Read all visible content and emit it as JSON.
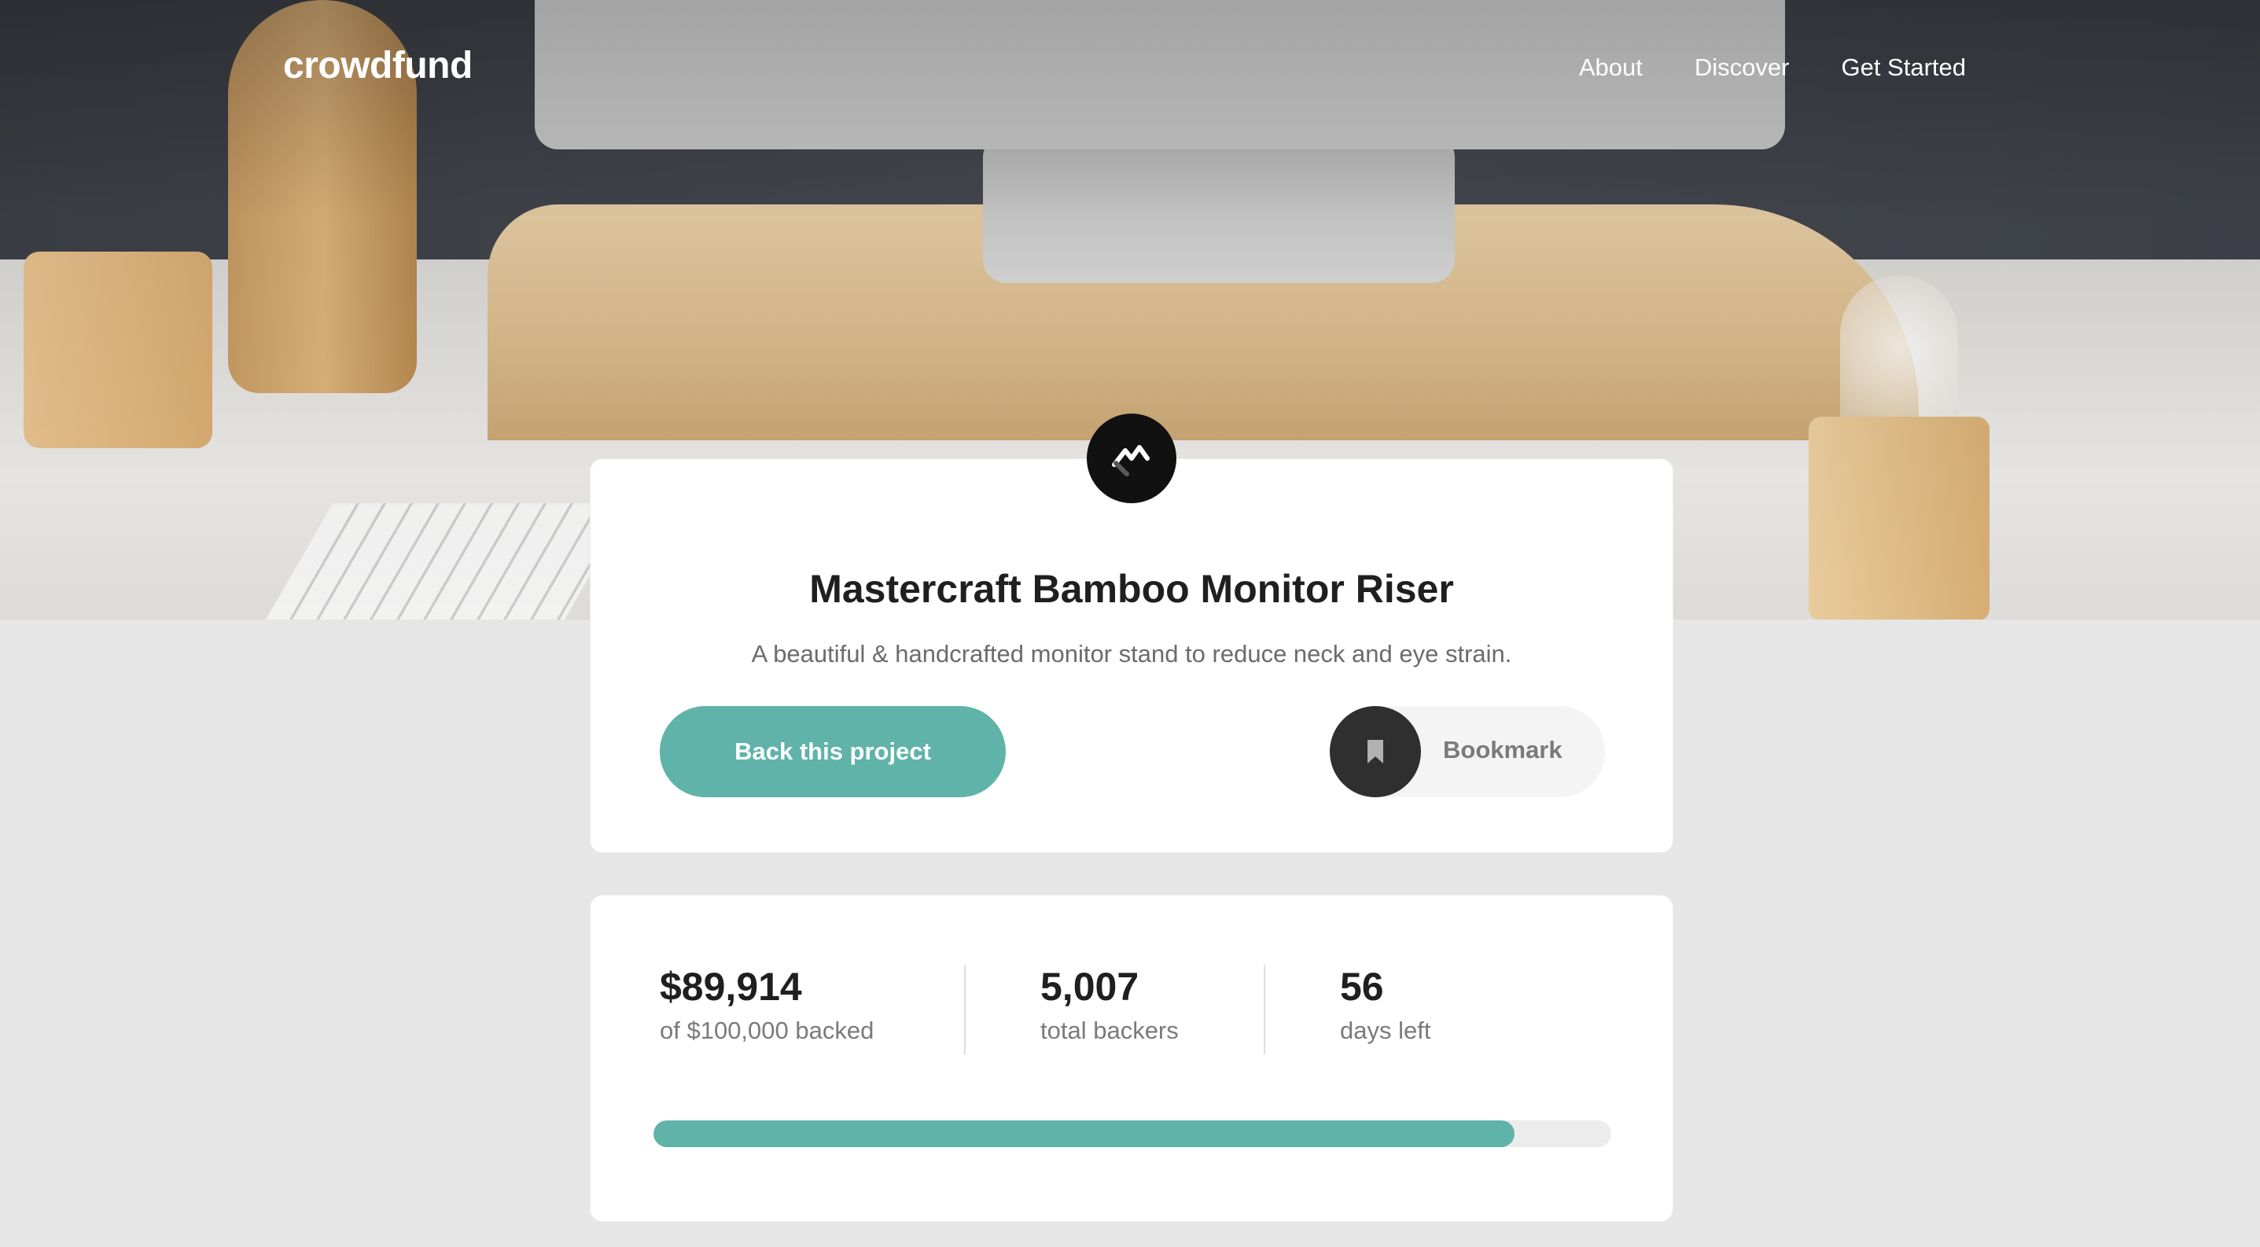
{
  "nav": {
    "logo": "crowdfund",
    "links": [
      "About",
      "Discover",
      "Get Started"
    ]
  },
  "project": {
    "logo_icon": "mastercraft-logo-icon",
    "title": "Mastercraft Bamboo Monitor Riser",
    "description": "A beautiful & handcrafted monitor stand to reduce neck and eye strain.",
    "back_label": "Back this project",
    "bookmark_label": "Bookmark",
    "bookmark_icon": "bookmark-icon"
  },
  "stats": {
    "backed_amount": "$89,914",
    "backed_label": "of $100,000 backed",
    "backers_count": "5,007",
    "backers_label": "total backers",
    "days_count": "56",
    "days_label": "days left",
    "progress_percent": 89.9
  },
  "colors": {
    "accent": "#5fb3a8",
    "background": "#e6e6e6",
    "card": "#ffffff",
    "bookmark_circle": "#2f2f2f"
  }
}
